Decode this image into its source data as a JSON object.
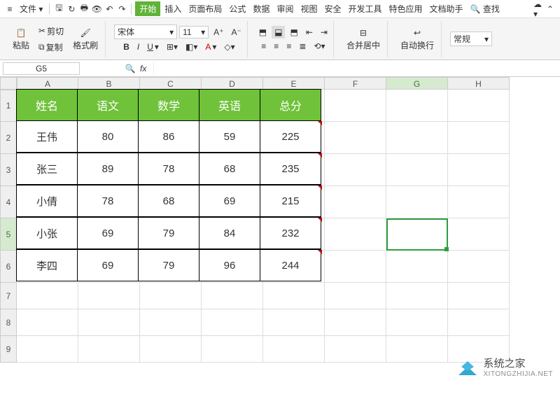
{
  "menu": {
    "file": "文件",
    "tabs": [
      "开始",
      "插入",
      "页面布局",
      "公式",
      "数据",
      "审阅",
      "视图",
      "安全",
      "开发工具",
      "特色应用",
      "文档助手"
    ],
    "search": "查找"
  },
  "ribbon": {
    "paste": "粘贴",
    "cut": "剪切",
    "copy": "复制",
    "format_painter": "格式刷",
    "font_name": "宋体",
    "font_size": "11",
    "merge": "合并居中",
    "wrap": "自动换行",
    "number_format": "常规"
  },
  "namebox": {
    "cell": "G5",
    "fx": "fx"
  },
  "columns": [
    "A",
    "B",
    "C",
    "D",
    "E",
    "F",
    "G",
    "H"
  ],
  "rows": [
    "1",
    "2",
    "3",
    "4",
    "5",
    "6",
    "7",
    "8",
    "9"
  ],
  "table": {
    "headers": [
      "姓名",
      "语文",
      "数学",
      "英语",
      "总分"
    ],
    "data": [
      [
        "王伟",
        "80",
        "86",
        "59",
        "225"
      ],
      [
        "张三",
        "89",
        "78",
        "68",
        "235"
      ],
      [
        "小倩",
        "78",
        "68",
        "69",
        "215"
      ],
      [
        "小张",
        "69",
        "79",
        "84",
        "232"
      ],
      [
        "李四",
        "69",
        "79",
        "96",
        "244"
      ]
    ]
  },
  "watermark": {
    "name": "系统之家",
    "url": "XITONGZHIJIA.NET"
  }
}
